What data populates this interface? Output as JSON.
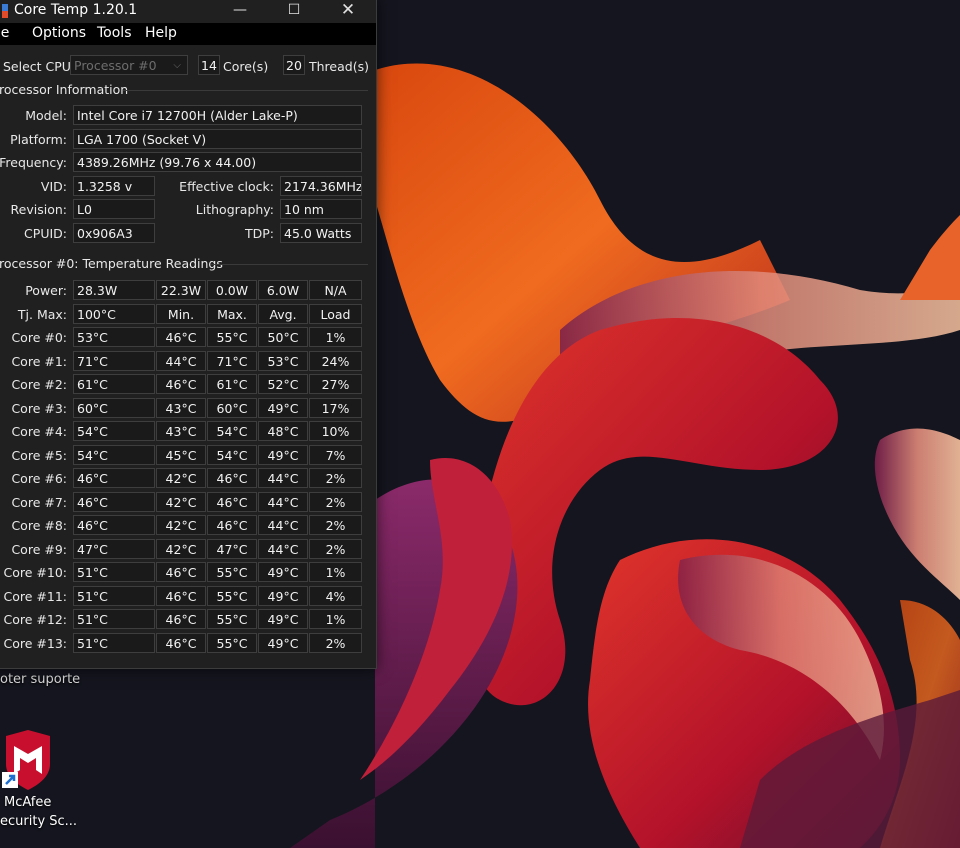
{
  "window": {
    "title": "Core Temp 1.20.1",
    "controls": {
      "minimize": "—",
      "maximize": "☐",
      "close": "✕"
    }
  },
  "menu": [
    "ile",
    "Options",
    "Tools",
    "Help"
  ],
  "cpu_select": {
    "label": "Select CPU:",
    "value": "Processor #0",
    "cores_value": "14",
    "cores_label": "Core(s)",
    "threads_value": "20",
    "threads_label": "Thread(s)"
  },
  "processor_info": {
    "title": "rocessor Information",
    "model_label": "Model:",
    "model": "Intel Core i7 12700H (Alder Lake-P)",
    "platform_label": "Platform:",
    "platform": "LGA 1700 (Socket V)",
    "frequency_label": "Frequency:",
    "frequency": "4389.26MHz (99.76 x 44.00)",
    "vid_label": "VID:",
    "vid": "1.3258 v",
    "effective_clock_label": "Effective clock:",
    "effective_clock": "2174.36MHz",
    "revision_label": "Revision:",
    "revision": "L0",
    "lithography_label": "Lithography:",
    "lithography": "10 nm",
    "cpuid_label": "CPUID:",
    "cpuid": "0x906A3",
    "tdp_label": "TDP:",
    "tdp": "45.0 Watts"
  },
  "temps": {
    "title": "rocessor #0: Temperature Readings",
    "power_label": "Power:",
    "power": [
      "28.3W",
      "22.3W",
      "0.0W",
      "6.0W",
      "N/A"
    ],
    "tjmax_label": "Tj. Max:",
    "tjmax": "100°C",
    "headers": [
      "Min.",
      "Max.",
      "Avg.",
      "Load"
    ],
    "cores": [
      {
        "label": "Core #0:",
        "temp": "53°C",
        "min": "46°C",
        "max": "55°C",
        "avg": "50°C",
        "load": "1%"
      },
      {
        "label": "Core #1:",
        "temp": "71°C",
        "min": "44°C",
        "max": "71°C",
        "avg": "53°C",
        "load": "24%"
      },
      {
        "label": "Core #2:",
        "temp": "61°C",
        "min": "46°C",
        "max": "61°C",
        "avg": "52°C",
        "load": "27%"
      },
      {
        "label": "Core #3:",
        "temp": "60°C",
        "min": "43°C",
        "max": "60°C",
        "avg": "49°C",
        "load": "17%"
      },
      {
        "label": "Core #4:",
        "temp": "54°C",
        "min": "43°C",
        "max": "54°C",
        "avg": "48°C",
        "load": "10%"
      },
      {
        "label": "Core #5:",
        "temp": "54°C",
        "min": "45°C",
        "max": "54°C",
        "avg": "49°C",
        "load": "7%"
      },
      {
        "label": "Core #6:",
        "temp": "46°C",
        "min": "42°C",
        "max": "46°C",
        "avg": "44°C",
        "load": "2%"
      },
      {
        "label": "Core #7:",
        "temp": "46°C",
        "min": "42°C",
        "max": "46°C",
        "avg": "44°C",
        "load": "2%"
      },
      {
        "label": "Core #8:",
        "temp": "46°C",
        "min": "42°C",
        "max": "46°C",
        "avg": "44°C",
        "load": "2%"
      },
      {
        "label": "Core #9:",
        "temp": "47°C",
        "min": "42°C",
        "max": "47°C",
        "avg": "44°C",
        "load": "2%"
      },
      {
        "label": "Core #10:",
        "temp": "51°C",
        "min": "46°C",
        "max": "55°C",
        "avg": "49°C",
        "load": "1%"
      },
      {
        "label": "Core #11:",
        "temp": "51°C",
        "min": "46°C",
        "max": "55°C",
        "avg": "49°C",
        "load": "4%"
      },
      {
        "label": "Core #12:",
        "temp": "51°C",
        "min": "46°C",
        "max": "55°C",
        "avg": "49°C",
        "load": "1%"
      },
      {
        "label": "Core #13:",
        "temp": "51°C",
        "min": "46°C",
        "max": "55°C",
        "avg": "49°C",
        "load": "2%"
      }
    ]
  },
  "desktop": {
    "caption": "oter suporte",
    "icon_label_1": "McAfee",
    "icon_label_2": "ecurity Sc...",
    "icon": "mcafee-shield-icon",
    "accent": "#c8102e"
  }
}
